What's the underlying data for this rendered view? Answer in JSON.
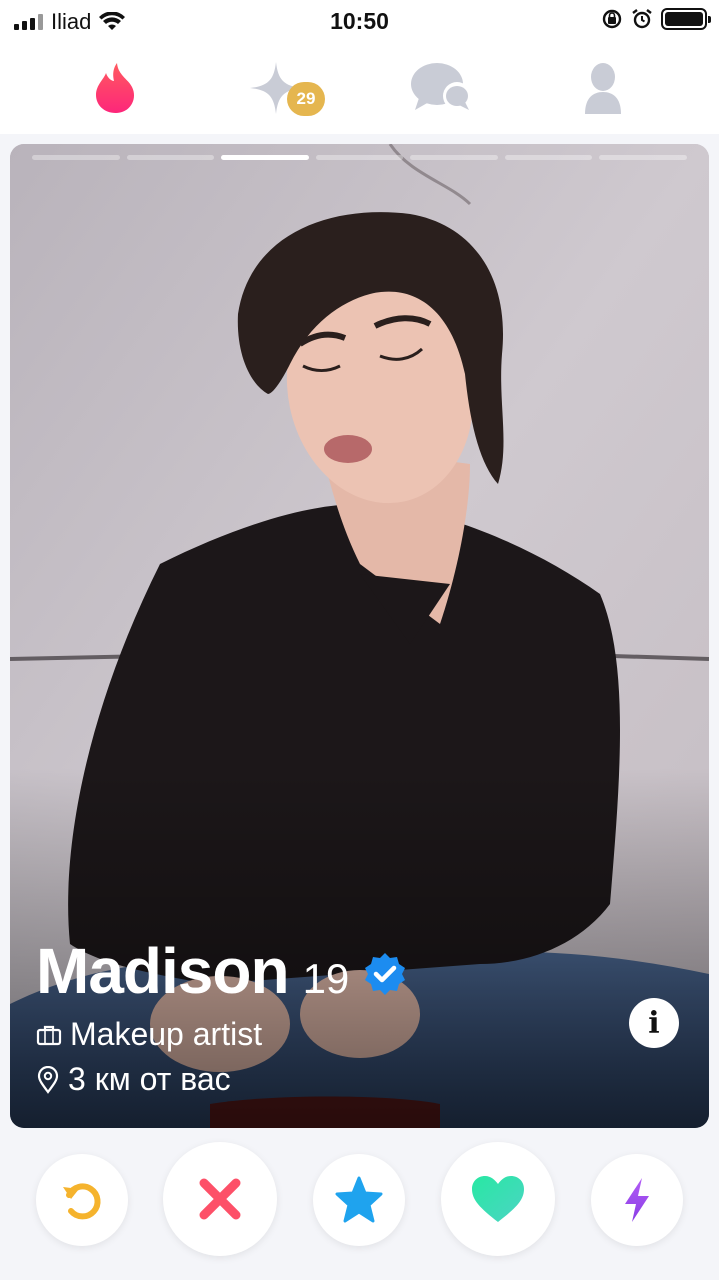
{
  "status_bar": {
    "carrier": "Iliad",
    "time": "10:50"
  },
  "top_nav": {
    "items": [
      {
        "icon": "flame-icon",
        "color": "#fd5068"
      },
      {
        "icon": "sparkle-icon",
        "badge": "29",
        "color": "#c9ccd6"
      },
      {
        "icon": "chat-icon",
        "color": "#c9ccd6"
      },
      {
        "icon": "profile-icon",
        "color": "#c9ccd6"
      }
    ],
    "badge_color": "#e5b64f"
  },
  "profile": {
    "name": "Madison",
    "age": "19",
    "verified": true,
    "job": "Makeup artist",
    "distance": "3 км от вас",
    "photo_index": 3,
    "photo_count": 7
  },
  "actions": [
    {
      "name": "rewind-button",
      "icon": "rewind-icon",
      "color": "#f5b32d"
    },
    {
      "name": "nope-button",
      "icon": "x-icon",
      "color": "#fd5068"
    },
    {
      "name": "super-like-button",
      "icon": "star-icon",
      "color": "#1fa3ee"
    },
    {
      "name": "like-button",
      "icon": "heart-icon",
      "color": "#35e1ae"
    },
    {
      "name": "boost-button",
      "icon": "bolt-icon",
      "color": "#a34cf0"
    }
  ]
}
